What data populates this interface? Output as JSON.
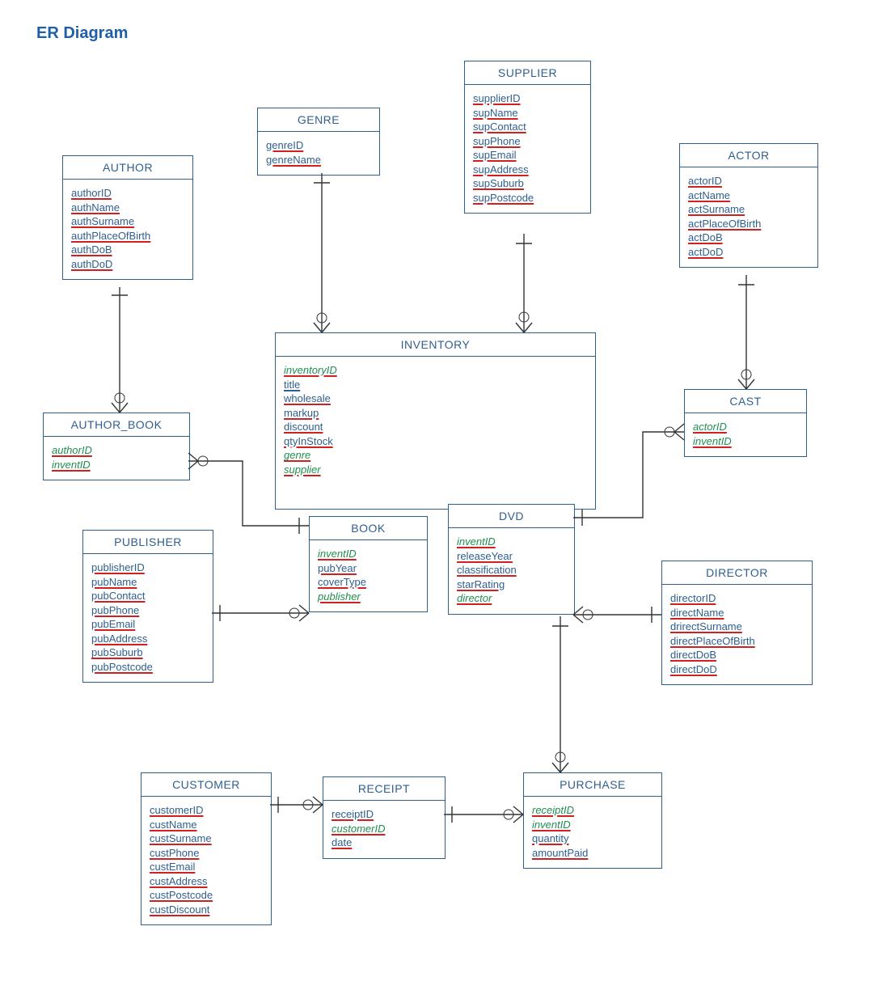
{
  "page_title": "ER Diagram",
  "entities": {
    "author": {
      "name": "AUTHOR",
      "attrs": [
        "authorID",
        "authName",
        "authSurname",
        "authPlaceOfBirth",
        "authDoB",
        "authDoD"
      ]
    },
    "genre": {
      "name": "GENRE",
      "attrs": [
        "genreID",
        "genreName"
      ]
    },
    "supplier": {
      "name": "SUPPLIER",
      "attrs": [
        "supplierID",
        "supName",
        "supContact",
        "supPhone",
        "supEmail",
        "supAddress",
        "supSuburb",
        "supPostcode"
      ]
    },
    "actor": {
      "name": "ACTOR",
      "attrs": [
        "actorID",
        "actName",
        "actSurname",
        "actPlaceOfBirth",
        "actDoB",
        "actDoD"
      ]
    },
    "author_book": {
      "name": "AUTHOR_BOOK",
      "fks": [
        "authorID",
        "inventID"
      ]
    },
    "inventory": {
      "name": "INVENTORY",
      "pk_fk": "inventoryID",
      "attrs": [
        "title",
        "wholesale",
        "markup",
        "discount",
        "qtyInStock"
      ],
      "fks": [
        "genre",
        "supplier"
      ]
    },
    "cast": {
      "name": "CAST",
      "fks": [
        "actorID",
        "inventID"
      ]
    },
    "publisher": {
      "name": "PUBLISHER",
      "attrs": [
        "publisherID",
        "pubName",
        "pubContact",
        "pubPhone",
        "pubEmail",
        "pubAddress",
        "pubSuburb",
        "pubPostcode"
      ]
    },
    "book": {
      "name": "BOOK",
      "pk_fk": "inventID",
      "attrs": [
        "pubYear",
        "coverType"
      ],
      "fks": [
        "publisher"
      ]
    },
    "dvd": {
      "name": "DVD",
      "pk_fk": "inventID",
      "attrs": [
        "releaseYear",
        "classification",
        "starRating"
      ],
      "fks": [
        "director"
      ]
    },
    "director": {
      "name": "DIRECTOR",
      "attrs": [
        "directorID",
        "directName",
        "drirectSurname",
        "directPlaceOfBirth",
        "directDoB",
        "directDoD"
      ]
    },
    "customer": {
      "name": "CUSTOMER",
      "attrs": [
        "customerID",
        "custName",
        "custSurname",
        "custPhone",
        "custEmail",
        "custAddress",
        "custPostcode",
        "custDiscount"
      ]
    },
    "receipt": {
      "name": "RECEIPT",
      "attrs": [
        "receiptID"
      ],
      "fks": [
        "customerID"
      ],
      "attrs2": [
        "date"
      ]
    },
    "purchase": {
      "name": "PURCHASE",
      "fks": [
        "receiptID",
        "inventID"
      ],
      "attrs": [
        "quantity",
        "amountPaid"
      ]
    }
  }
}
